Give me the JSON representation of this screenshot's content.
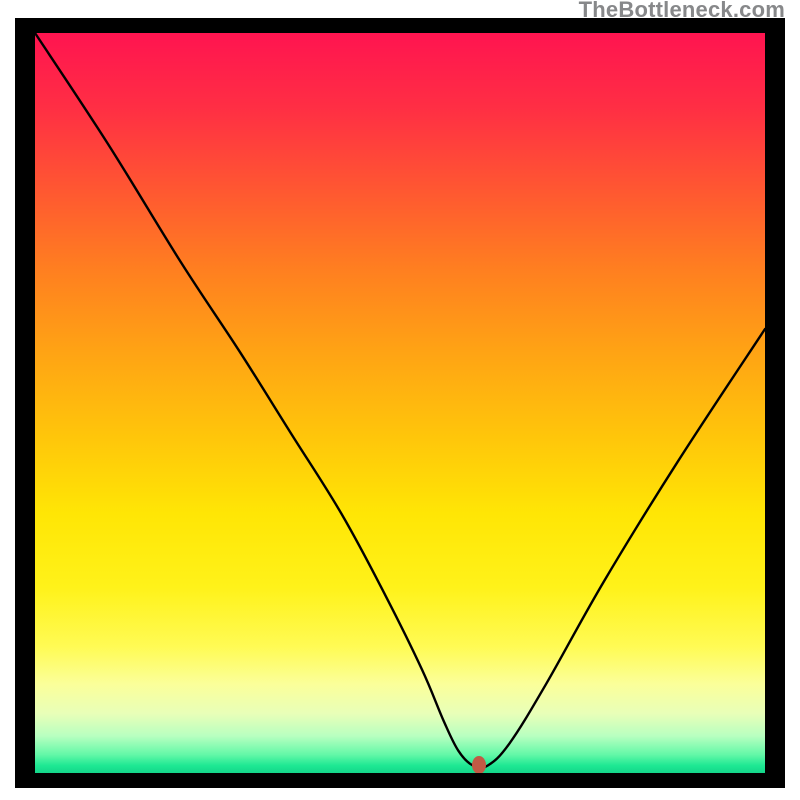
{
  "watermark": "TheBottleneck.com",
  "chart_data": {
    "type": "line",
    "title": "",
    "xlabel": "",
    "ylabel": "",
    "xlim": [
      0,
      100
    ],
    "ylim": [
      0,
      100
    ],
    "grid": false,
    "series": [
      {
        "name": "curve",
        "x": [
          0,
          10,
          20,
          28,
          35,
          42,
          48,
          53,
          56,
          58,
          60,
          62,
          65,
          70,
          78,
          88,
          100
        ],
        "values": [
          100,
          85,
          69,
          57,
          46,
          35,
          24,
          14,
          7,
          3,
          1,
          1,
          4,
          12,
          26,
          42,
          60
        ]
      }
    ],
    "marker": {
      "x_norm": 0.608,
      "y_norm": 0.989,
      "color": "#c25a45"
    },
    "background_gradient_stops": [
      {
        "pos": 0.0,
        "color": "#ff1450"
      },
      {
        "pos": 0.5,
        "color": "#ffc70a"
      },
      {
        "pos": 0.85,
        "color": "#fffb55"
      },
      {
        "pos": 1.0,
        "color": "#14d68a"
      }
    ]
  }
}
